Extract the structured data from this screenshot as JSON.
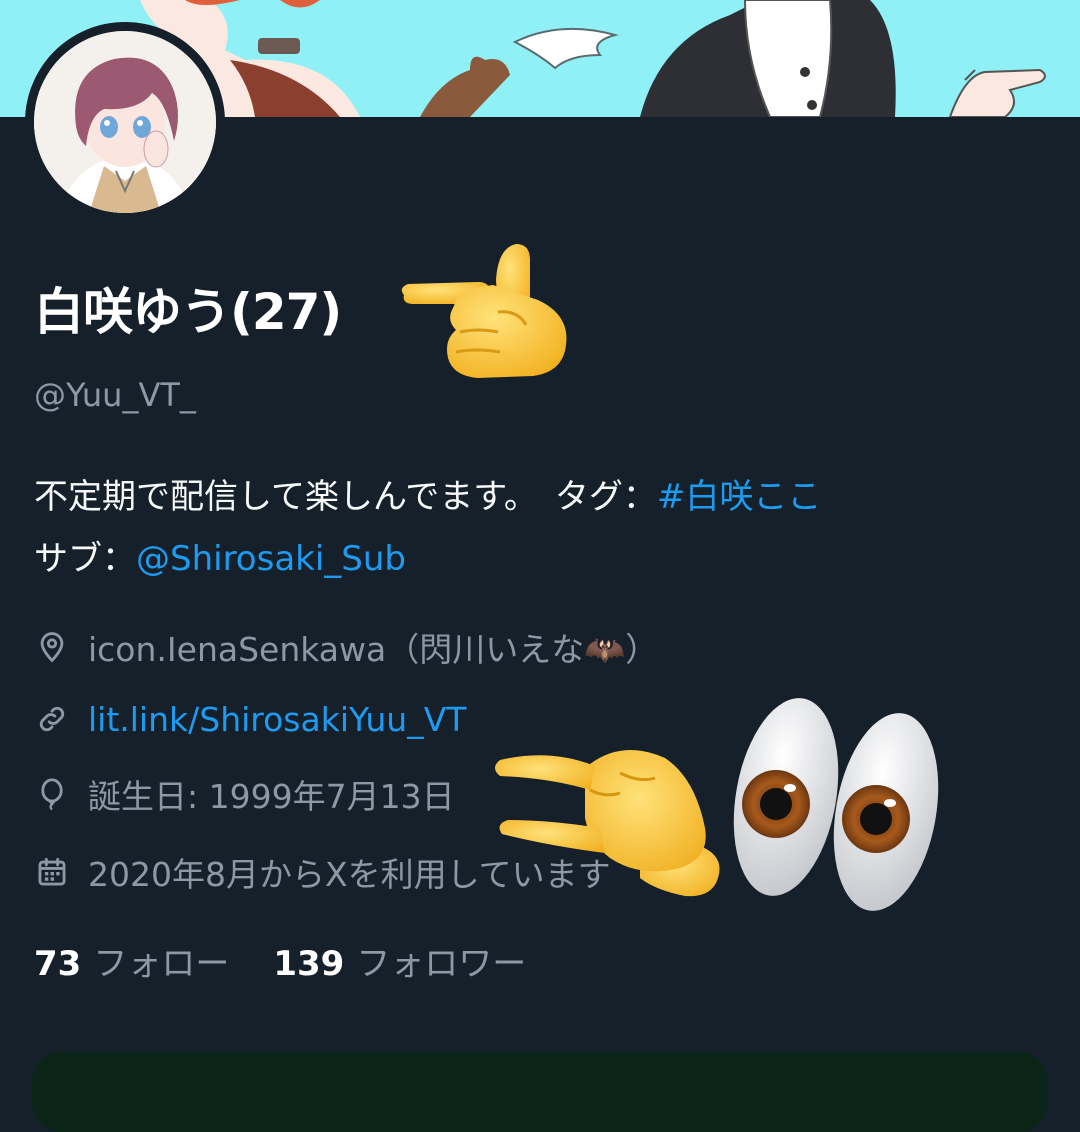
{
  "profile": {
    "display_name": "白咲ゆう(27)",
    "handle": "@Yuu_VT_",
    "bio": {
      "line1_text": "不定期で配信して楽しんでます。　タグ：",
      "line1_tag": "#白咲ここ",
      "line2_text": "サブ：",
      "line2_mention": "@Shirosaki_Sub"
    },
    "location": "icon.IenaSenkawa（閃川いえな🦇）",
    "website": "lit.link/ShirosakiYuu_VT",
    "birthday": "誕生日: 1999年7月13日",
    "joined": "2020年8月からXを利用しています"
  },
  "stats": {
    "following_count": "73",
    "following_label": "フォロー",
    "followers_count": "139",
    "followers_label": "フォロワー"
  },
  "icons": {
    "location": "map-pin-icon",
    "website": "link-icon",
    "birthday": "balloon-icon",
    "joined": "calendar-icon"
  },
  "stickers": [
    "pointing-hand-emoji",
    "pinching-hand-emoji",
    "eyes-emoji"
  ],
  "colors": {
    "background": "#15202b",
    "link": "#1d9bf0",
    "secondary_text": "#8b98a5",
    "banner_bg": "#8ff0f5",
    "emoji_yellow": "#f7c531"
  }
}
